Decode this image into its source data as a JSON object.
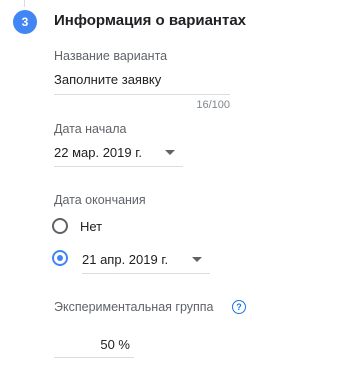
{
  "step": {
    "number": "3",
    "title": "Информация о вариантах"
  },
  "variant_name": {
    "label": "Название варианта",
    "value": "Заполните заявку",
    "counter": "16/100"
  },
  "start_date": {
    "label": "Дата начала",
    "value": "22 мар. 2019 г."
  },
  "end_date": {
    "label": "Дата окончания",
    "options": [
      {
        "label": "Нет",
        "selected": false
      },
      {
        "label": "21 апр. 2019 г.",
        "selected": true
      }
    ]
  },
  "experiment_group": {
    "label": "Экспериментальная группа",
    "help_icon": "?",
    "value": "50 %"
  },
  "colors": {
    "accent": "#4285f4",
    "help": "#1a73e8"
  }
}
